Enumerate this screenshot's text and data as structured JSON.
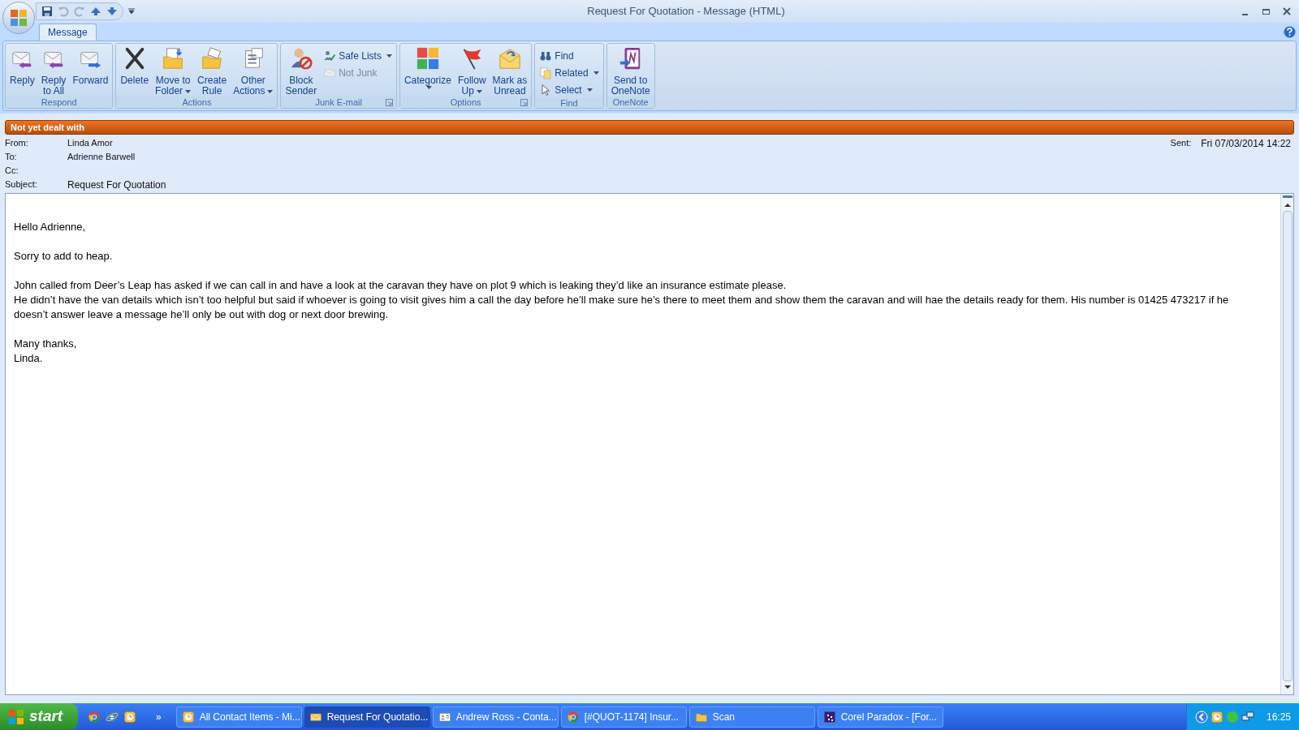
{
  "window": {
    "title": "Request For Quotation - Message (HTML)"
  },
  "tabs": [
    {
      "label": "Message",
      "selected": true
    }
  ],
  "ribbon": [
    {
      "label": "Respond",
      "launcher": false,
      "buttons": [
        {
          "kind": "large",
          "lines": [
            "Reply"
          ],
          "dropdown": false,
          "disabled": false
        },
        {
          "kind": "large",
          "lines": [
            "Reply",
            "to All"
          ],
          "dropdown": false,
          "disabled": false
        },
        {
          "kind": "large",
          "lines": [
            "Forward"
          ],
          "dropdown": false,
          "disabled": false
        }
      ]
    },
    {
      "label": "Actions",
      "launcher": false,
      "buttons": [
        {
          "kind": "large",
          "lines": [
            "Delete"
          ],
          "dropdown": false,
          "disabled": false
        },
        {
          "kind": "large",
          "lines": [
            "Move to",
            "Folder"
          ],
          "dropdown": true,
          "disabled": false
        },
        {
          "kind": "large",
          "lines": [
            "Create",
            "Rule"
          ],
          "dropdown": false,
          "disabled": false
        },
        {
          "kind": "large",
          "lines": [
            "Other",
            "Actions"
          ],
          "dropdown": true,
          "disabled": false
        }
      ]
    },
    {
      "label": "Junk E-mail",
      "launcher": true,
      "buttons": [
        {
          "kind": "large",
          "lines": [
            "Block",
            "Sender"
          ],
          "dropdown": false,
          "disabled": false
        },
        {
          "kind": "small",
          "lines": [
            "Safe Lists"
          ],
          "dropdown": true,
          "disabled": false
        },
        {
          "kind": "small",
          "lines": [
            "Not Junk"
          ],
          "dropdown": false,
          "disabled": true
        }
      ]
    },
    {
      "label": "Options",
      "launcher": true,
      "buttons": [
        {
          "kind": "large",
          "lines": [
            "Categorize"
          ],
          "dropdown": true,
          "disabled": false
        },
        {
          "kind": "large",
          "lines": [
            "Follow",
            "Up"
          ],
          "dropdown": true,
          "disabled": false
        },
        {
          "kind": "large",
          "lines": [
            "Mark as",
            "Unread"
          ],
          "dropdown": false,
          "disabled": false
        }
      ]
    },
    {
      "label": "Find",
      "launcher": false,
      "buttons": [
        {
          "kind": "small",
          "lines": [
            "Find"
          ],
          "dropdown": false,
          "disabled": false
        },
        {
          "kind": "small",
          "lines": [
            "Related"
          ],
          "dropdown": true,
          "disabled": false
        },
        {
          "kind": "small",
          "lines": [
            "Select"
          ],
          "dropdown": true,
          "disabled": false
        }
      ]
    },
    {
      "label": "OneNote",
      "launcher": false,
      "buttons": [
        {
          "kind": "large",
          "lines": [
            "Send to",
            "OneNote"
          ],
          "dropdown": false,
          "disabled": false
        }
      ]
    }
  ],
  "flag_banner": "Not yet dealt with",
  "header": {
    "fields": [
      {
        "label": "From:",
        "value": "Linda Amor"
      },
      {
        "label": "To:",
        "value": "Adrienne Barwell"
      },
      {
        "label": "Cc:"
      },
      {
        "label": "Subject:",
        "value": "Request For Quotation"
      }
    ],
    "sent_label": "Sent:",
    "sent_value": "Fri 07/03/2014 14:22"
  },
  "body": [
    [
      "Hello Adrienne,"
    ],
    [
      "Sorry to add to heap."
    ],
    [
      "John called from Deer’s Leap has asked if we can call in and have a look at the caravan they have on plot 9 which is leaking they’d like an insurance estimate please.",
      "He didn’t have the van details which isn’t too helpful but said if whoever is going to visit gives him a call the day before he’ll make sure he’s there to meet them and show them the caravan and will hae the details ready for them.  His number is 01425 473217 if he doesn’t answer leave a message he’ll only be out with dog or next door brewing."
    ],
    [
      "Many thanks,",
      "Linda."
    ]
  ],
  "taskbar": {
    "start": "start",
    "overflow": "»",
    "items": [
      {
        "label": "All Contact Items - Mi...",
        "selected": false
      },
      {
        "label": "Request For Quotatio...",
        "selected": true
      },
      {
        "label": "Andrew Ross - Conta...",
        "selected": false
      },
      {
        "label": "[#QUOT-1174] Insur...",
        "selected": false
      },
      {
        "label": "Scan",
        "selected": false
      },
      {
        "label": "Corel Paradox - [For...",
        "selected": false
      }
    ],
    "clock": "16:25"
  }
}
